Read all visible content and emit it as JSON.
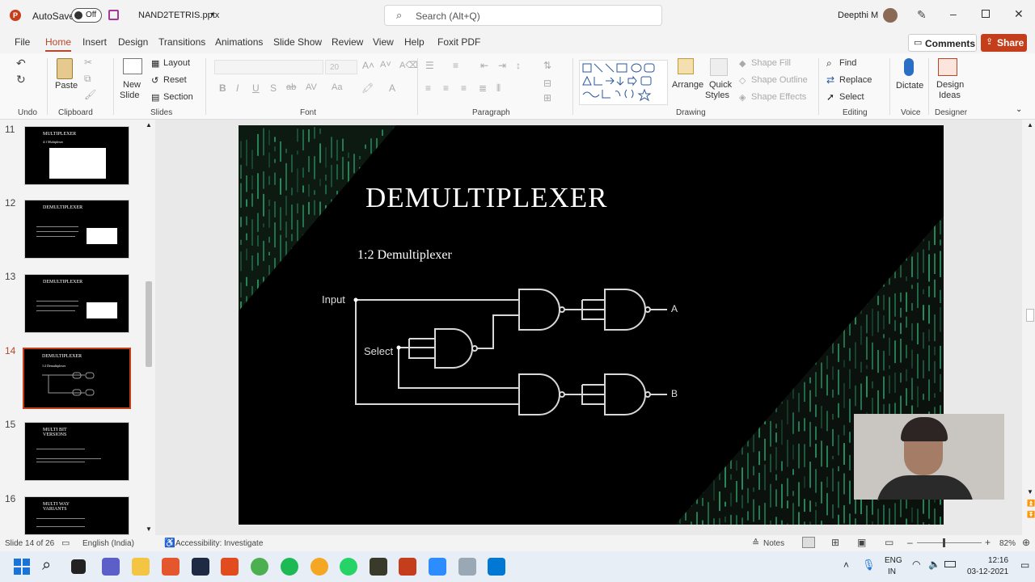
{
  "titlebar": {
    "autosave_label": "AutoSave",
    "autosave_state": "Off",
    "filename": "NAND2TETRIS.pptx",
    "search_placeholder": "Search (Alt+Q)",
    "user_name": "Deepthi M"
  },
  "tabs": [
    "File",
    "Home",
    "Insert",
    "Design",
    "Transitions",
    "Animations",
    "Slide Show",
    "Review",
    "View",
    "Help",
    "Foxit PDF"
  ],
  "active_tab": "Home",
  "header_actions": {
    "comments": "Comments",
    "share": "Share"
  },
  "ribbon": {
    "undo_label": "Undo",
    "clipboard": {
      "paste": "Paste",
      "label": "Clipboard"
    },
    "slides": {
      "new_slide_1": "New",
      "new_slide_2": "Slide",
      "layout": "Layout",
      "reset": "Reset",
      "section": "Section",
      "label": "Slides"
    },
    "font": {
      "size": "20",
      "label": "Font"
    },
    "paragraph": {
      "label": "Paragraph"
    },
    "drawing": {
      "arrange": "Arrange",
      "quick_styles_1": "Quick",
      "quick_styles_2": "Styles",
      "shape_fill": "Shape Fill",
      "shape_outline": "Shape Outline",
      "shape_effects": "Shape Effects",
      "label": "Drawing"
    },
    "editing": {
      "find": "Find",
      "replace": "Replace",
      "select": "Select",
      "label": "Editing"
    },
    "voice": {
      "dictate": "Dictate",
      "label": "Voice"
    },
    "designer": {
      "design_ideas_1": "Design",
      "design_ideas_2": "Ideas",
      "label": "Designer"
    }
  },
  "thumbnails": [
    {
      "num": "11",
      "title": "MULTIPLEXER",
      "sub": "4:1 Multiplexer"
    },
    {
      "num": "12",
      "title": "DEMULTIPLEXER",
      "sub": ""
    },
    {
      "num": "13",
      "title": "DEMULTIPLEXER",
      "sub": ""
    },
    {
      "num": "14",
      "title": "DEMULTIPLEXER",
      "sub": "1:2 Demultiplexer"
    },
    {
      "num": "15",
      "title": "MULTI BIT VERSIONS",
      "sub": ""
    },
    {
      "num": "16",
      "title": "MULTI WAY VARIANTS",
      "sub": ""
    }
  ],
  "slide": {
    "title": "DEMULTIPLEXER",
    "subtitle": "1:2  Demultiplexer",
    "input_label": "Input",
    "select_label": "Select",
    "out_a": "A",
    "out_b": "B"
  },
  "statusbar": {
    "slide_info": "Slide 14 of 26",
    "language": "English (India)",
    "accessibility": "Accessibility: Investigate",
    "notes": "Notes",
    "zoom": "82%"
  },
  "taskbar": {
    "lang1": "ENG",
    "lang2": "IN",
    "time": "12:16",
    "date": "03-12-2021"
  },
  "colors": {
    "accent": "#b7472a",
    "share_bg": "#c43e1c",
    "matrix_green": "#2fa06a",
    "slide_bg": "#000000"
  }
}
